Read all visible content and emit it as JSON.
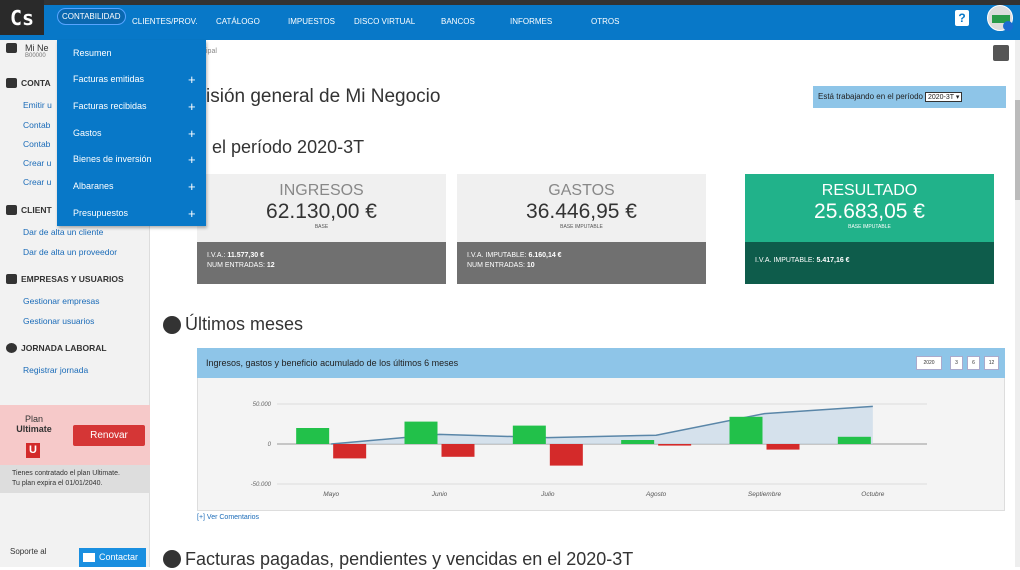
{
  "header": {
    "logo": "Cs",
    "nav": [
      "CONTABILIDAD",
      "CLIENTES/PROV.",
      "CATÁLOGO",
      "IMPUESTOS",
      "DISCO VIRTUAL",
      "BANCOS",
      "INFORMES",
      "OTROS"
    ],
    "help": "?"
  },
  "dropdown": {
    "items": [
      "Resumen",
      "Facturas emitidas",
      "Facturas recibidas",
      "Gastos",
      "Bienes de inversión",
      "Albaranes",
      "Presupuestos"
    ],
    "plus": "+"
  },
  "sidebar": {
    "business_name": "Mi Ne",
    "business_id": "B00000",
    "section_conta": "CONTA",
    "conta_links": [
      "Emitir u",
      "Contab",
      "Contab",
      "Crear u",
      "Crear u"
    ],
    "section_clientes": "CLIENT",
    "clientes_links": [
      "Dar de alta un cliente",
      "Dar de alta un proveedor"
    ],
    "section_empresas": "EMPRESAS Y USUARIOS",
    "empresas_links": [
      "Gestionar empresas",
      "Gestionar usuarios"
    ],
    "section_jornada": "JORNADA LABORAL",
    "jornada_links": [
      "Registrar jornada"
    ],
    "plan_label": "Plan",
    "plan_name": "Ultimate",
    "plan_badge": "U",
    "renovar": "Renovar",
    "plan_info_1": "Tienes contratado el plan Ultimate.",
    "plan_info_2": "Tu plan expira el 01/01/2040.",
    "soporte": "Soporte al",
    "contactar": "Contactar"
  },
  "breadcrumb": "ipal",
  "main": {
    "title": "isión general de Mi Negocio",
    "period_label": "Está trabajando en el período",
    "period_value": "2020-3T ▾",
    "period_title": "el período 2020-3T",
    "cards": [
      {
        "label": "INGRESOS",
        "amount": "62.130,00 €",
        "sub": "BASE",
        "line1_label": "I.V.A.:",
        "line1_value": "11.577,30 €",
        "line2_label": "NUM ENTRADAS:",
        "line2_value": "12"
      },
      {
        "label": "GASTOS",
        "amount": "36.446,95 €",
        "sub": "BASE IMPUTABLE",
        "line1_label": "I.V.A. IMPUTABLE:",
        "line1_value": "6.160,14 €",
        "line2_label": "NUM ENTRADAS:",
        "line2_value": "10"
      },
      {
        "label": "RESULTADO",
        "amount": "25.683,05 €",
        "sub": "BASE IMPUTABLE",
        "line1_label": "I.V.A. IMPUTABLE:",
        "line1_value": "5.417,16 €"
      }
    ],
    "section_ultimos": "Últimos meses",
    "chart_title": "Ingresos, gastos y beneficio acumulado de los últimos 6 meses",
    "chart_buttons": [
      "2020",
      "3",
      "6",
      "12"
    ],
    "ver_comentarios": "[+] Ver Comentarios",
    "section_facturas": "Facturas pagadas, pendientes y vencidas en el 2020-3T"
  },
  "colors": {
    "brand": "#0878c8",
    "income": "#22c14a",
    "expense": "#d42a2a",
    "result": "#21b28a"
  },
  "chart_data": {
    "type": "bar",
    "categories": [
      "Mayo",
      "Junio",
      "Julio",
      "Agosto",
      "Septiembre",
      "Octubre"
    ],
    "ylim": [
      -50000,
      50000
    ],
    "yticks": [
      "50.000",
      "0",
      "-50.000"
    ],
    "series": [
      {
        "values": [
          20000,
          28000,
          23000,
          5000,
          34000,
          9000
        ]
      },
      {
        "values": [
          -18000,
          -16000,
          -27000,
          -2000,
          -7000,
          0
        ]
      },
      {
        "values": [
          0,
          12000,
          8000,
          11000,
          38000,
          47000
        ]
      }
    ]
  }
}
